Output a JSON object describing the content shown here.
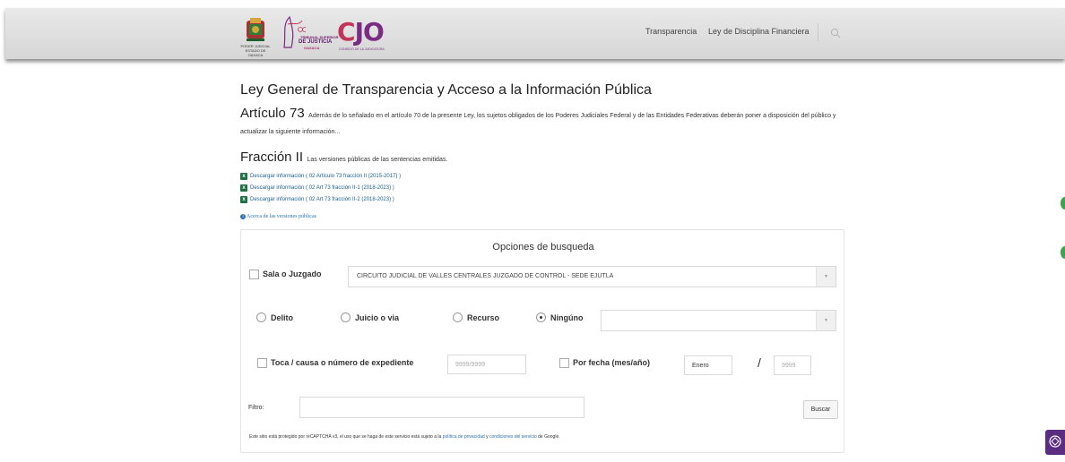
{
  "header": {
    "logo1_caption": "PODER JUDICIAL\nESTADO DE OAXACA",
    "logo2_line1": "TRIBUNAL SUPERIOR",
    "logo2_line2": "DE JUSTICIA",
    "logo2_line3": "OAXACA",
    "logo3_mark_c": "C",
    "logo3_mark_jo": "JO",
    "logo3_sub": "CONSEJO DE LA JUDICATURA",
    "nav_items": [
      "Transparencia",
      "Ley de Disciplina Financiera"
    ]
  },
  "content": {
    "main_title": "Ley General de Transparencia y Acceso a la Información Pública",
    "article_title": "Artículo 73",
    "article_text": "Además de lo señalado en el artículo 70 de la presente Ley, los sujetos obligados de los Poderes Judiciales Federal y de las Entidades Federativas deberán poner a disposición del público y actualizar la siguiente información...",
    "fraction_title": "Fracción II",
    "fraction_text": "Las versiones públicas de las sentencias emitidas.",
    "downloads": [
      "Descargar información ( 02 Artículo 73 fracción II (2015-2017) )",
      "Descargar información ( 02 Art 73 fracción II-1 (2018-2023) )",
      "Descargar información ( 02 Art 73 fracción II-2 (2018-2023) )"
    ],
    "about_link": "Acerca de las versiones públicas"
  },
  "search": {
    "title": "Opciones de busqueda",
    "sala_label": "Sala o Juzgado",
    "sala_value": "CIRCUITO JUDICIAL DE VALLES CENTRALES JUZGADO DE CONTROL - SEDE EJUTLA",
    "radios": [
      {
        "label": "Delito",
        "checked": false
      },
      {
        "label": "Juicio o via",
        "checked": false
      },
      {
        "label": "Recurso",
        "checked": false
      },
      {
        "label": "Ningúno",
        "checked": true
      }
    ],
    "toca_label": "Toca / causa o número de expediente",
    "toca_placeholder": "9999/9999",
    "fecha_label": "Por fecha (mes/año)",
    "month_value": "Enero",
    "date_separator": "/",
    "year_placeholder": "9999",
    "filter_label": "Filtro:",
    "filter_value": "",
    "search_button": "Buscar",
    "legal_prefix": "Este sitio está protegido por reCAPTCHA v3, el uso que se haga de este servicio está sujeto a la",
    "legal_privacy": "política de privacidad",
    "legal_and": "y",
    "legal_terms": "condiciones del servicio",
    "legal_suffix": "de Google."
  },
  "colors": {
    "accent_link": "#2a73b3",
    "excel_green": "#1e7145",
    "recaptcha_purple": "#5a2d82"
  }
}
